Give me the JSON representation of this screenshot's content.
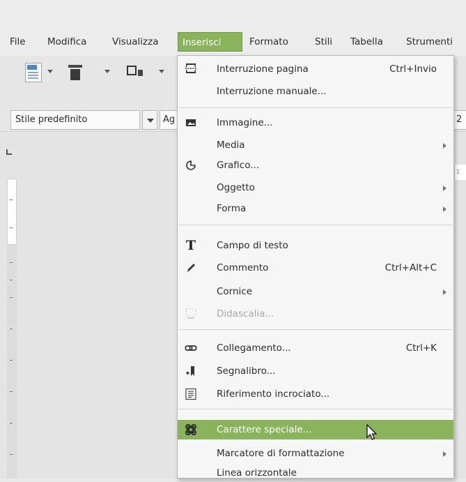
{
  "menubar": {
    "items": [
      "File",
      "Modifica",
      "Visualizza",
      "Inserisci",
      "Formato",
      "Stili",
      "Tabella",
      "Strumenti"
    ],
    "active": "Inserisci"
  },
  "toolbar2": {
    "paragraph_style": "Stile predefinito",
    "font_name": "Ag",
    "font_size": "2"
  },
  "ruler": {
    "h_tick": "1"
  },
  "menu": {
    "items": [
      {
        "label": "Interruzione pagina",
        "accel": "Ctrl+Invio",
        "icon": "page-break-icon"
      },
      {
        "label": "Interruzione manuale...",
        "accel": "",
        "icon": ""
      },
      {
        "label": "Immagine...",
        "accel": "",
        "icon": "image-icon"
      },
      {
        "label": "Media",
        "accel": "",
        "icon": "",
        "submenu": true
      },
      {
        "label": "Grafico...",
        "accel": "",
        "icon": "chart-icon"
      },
      {
        "label": "Oggetto",
        "accel": "",
        "icon": "",
        "submenu": true
      },
      {
        "label": "Forma",
        "accel": "",
        "icon": "",
        "submenu": true
      },
      {
        "label": "Campo di testo",
        "accel": "",
        "icon": "text-box-icon"
      },
      {
        "label": "Commento",
        "accel": "Ctrl+Alt+C",
        "icon": "comment-pencil-icon"
      },
      {
        "label": "Cornice",
        "accel": "",
        "icon": "",
        "submenu": true
      },
      {
        "label": "Didascalia...",
        "accel": "",
        "icon": "caption-icon",
        "disabled": true
      },
      {
        "label": "Collegamento...",
        "accel": "Ctrl+K",
        "icon": "hyperlink-icon"
      },
      {
        "label": "Segnalibro...",
        "accel": "",
        "icon": "bookmark-icon"
      },
      {
        "label": "Riferimento incrociato...",
        "accel": "",
        "icon": "cross-reference-icon"
      },
      {
        "label": "Carattere speciale...",
        "accel": "",
        "icon": "special-character-icon",
        "highlighted": true
      },
      {
        "label": "Marcatore di formattazione",
        "accel": "",
        "icon": "",
        "submenu": true
      },
      {
        "label": "Linea orizzontale",
        "accel": "",
        "icon": ""
      }
    ]
  },
  "colors": {
    "highlight": "#8ab35b",
    "menu_bg": "#f6f6f6",
    "disabled_text": "#a8a8a8"
  }
}
